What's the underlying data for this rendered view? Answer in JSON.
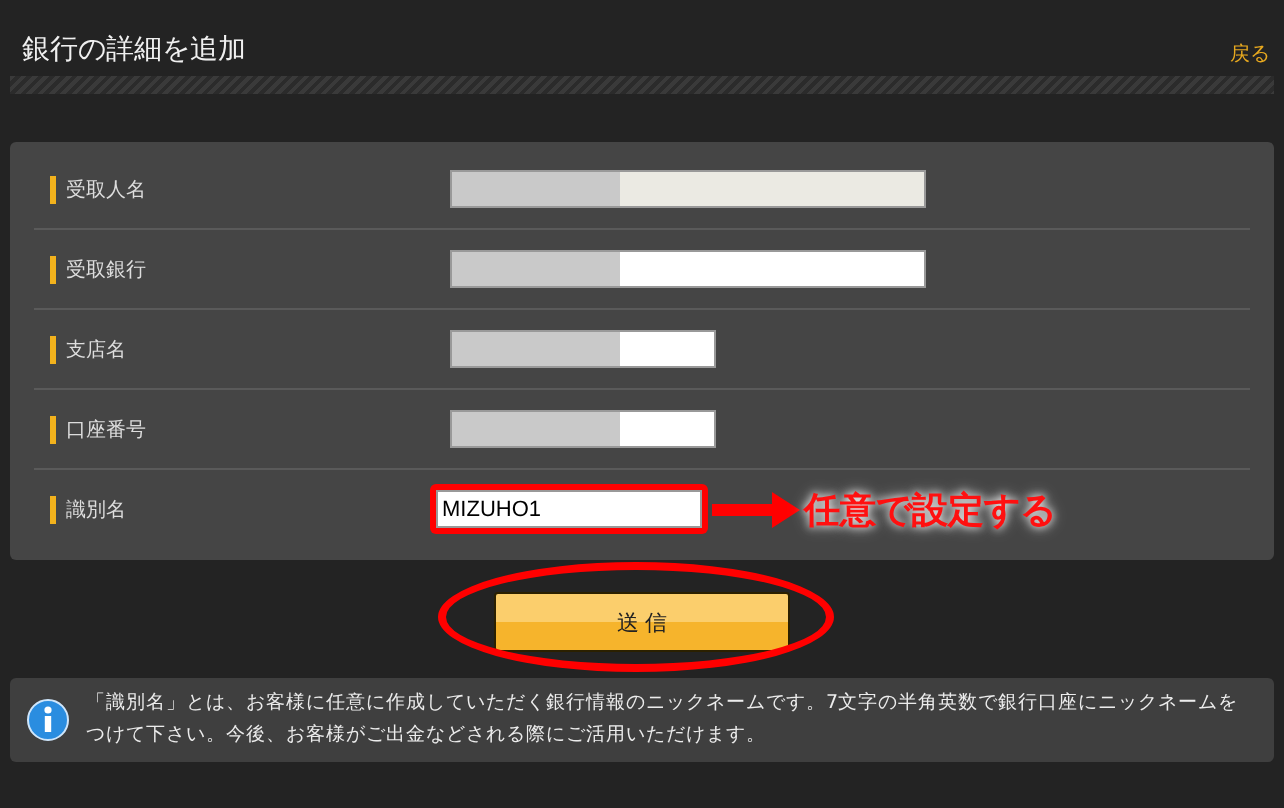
{
  "header": {
    "title": "銀行の詳細を追加",
    "back_link": "戻る"
  },
  "form": {
    "fields": [
      {
        "label": "受取人名",
        "kind": "long",
        "readonly": true,
        "redacted": true
      },
      {
        "label": "受取銀行",
        "kind": "long",
        "readonly": false,
        "redacted": true
      },
      {
        "label": "支店名",
        "kind": "short",
        "readonly": false,
        "redacted": true
      },
      {
        "label": "口座番号",
        "kind": "short",
        "readonly": false,
        "redacted": true
      },
      {
        "label": "識別名",
        "kind": "short",
        "readonly": false,
        "redacted": false,
        "value": "MIZUHO1",
        "highlighted": true,
        "annotation": "任意で設定する"
      }
    ]
  },
  "submit_button": {
    "label": "送 信",
    "highlighted": true
  },
  "info": {
    "text": "「識別名」とは、お客様に任意に作成していただく銀行情報のニックネームです。7文字の半角英数で銀行口座にニックネームをつけて下さい。今後、お客様がご出金などされる際にご活用いただけます。"
  }
}
